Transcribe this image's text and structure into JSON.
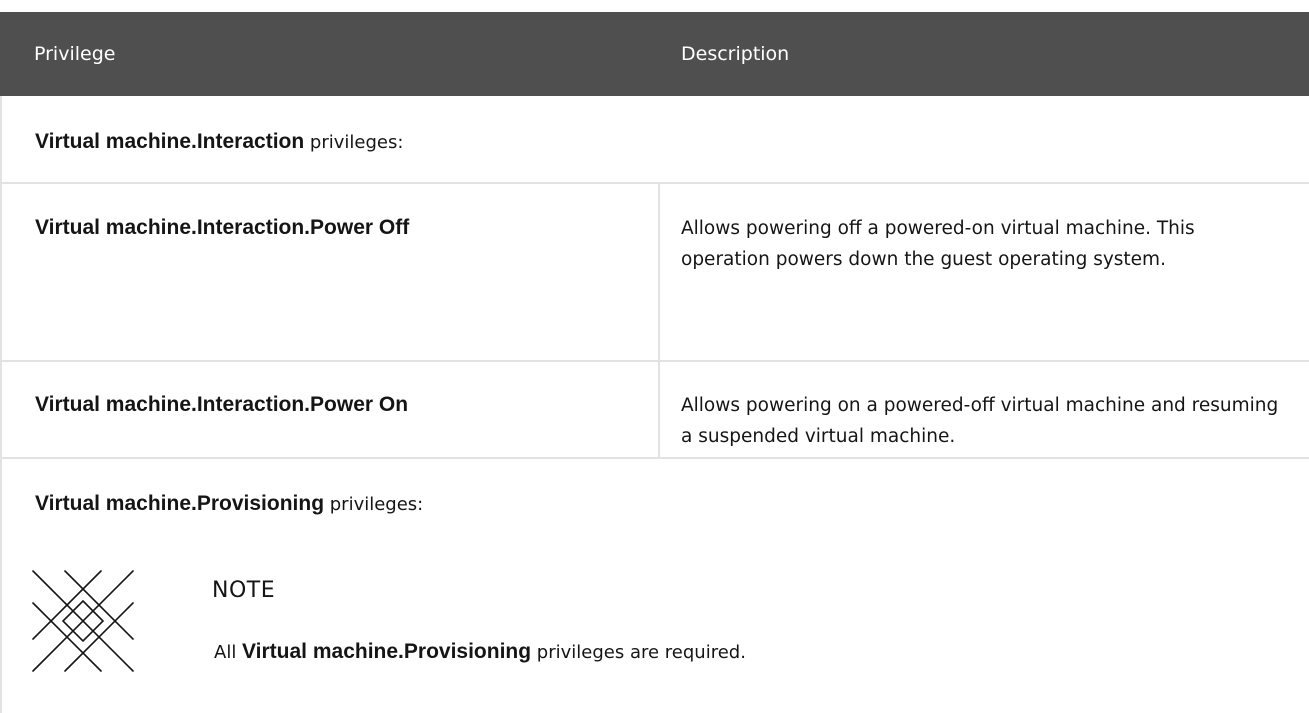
{
  "table": {
    "headers": {
      "privilege": "Privilege",
      "description": "Description"
    },
    "sections": [
      {
        "strong": "Virtual machine.Interaction",
        "suffix": " privileges:"
      },
      {
        "strong": "Virtual machine.Provisioning",
        "suffix": " privileges:"
      }
    ],
    "rows": [
      {
        "name": "Virtual machine.Interaction.Power Off",
        "description": "Allows powering off a powered-on virtual machine. This operation powers down the guest operating system."
      },
      {
        "name": "Virtual machine.Interaction.Power On",
        "description": "Allows powering on a powered-off virtual machine and resuming a suspended virtual machine."
      }
    ]
  },
  "note": {
    "icon": "note-icon",
    "title": "NOTE",
    "prefix": "All ",
    "strong": "Virtual machine.Provisioning",
    "suffix": " privileges are required."
  }
}
